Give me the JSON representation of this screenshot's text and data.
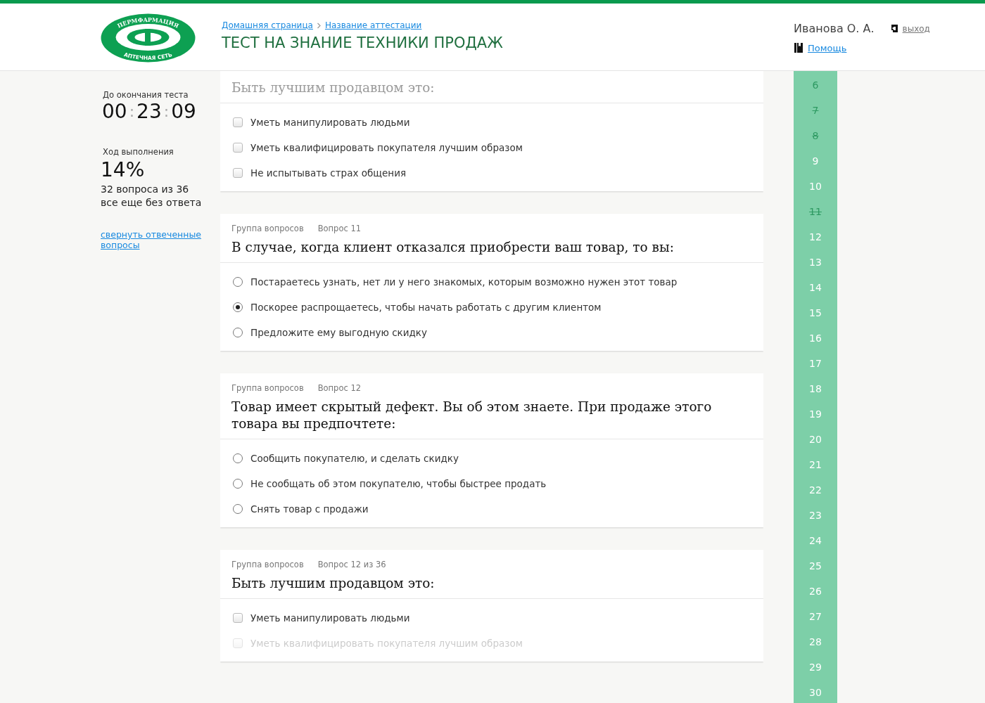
{
  "logo": {
    "top_text": "ПЕРМФАРМАЦИЯ",
    "bottom_text": "АПТЕЧНАЯ СЕТЬ"
  },
  "breadcrumbs": [
    "Домашняя страница",
    "Название аттестации"
  ],
  "page_title": "ТЕСТ НА ЗНАНИЕ ТЕХНИКИ ПРОДАЖ",
  "user": {
    "name": "Иванова О. А.",
    "logout": "выход",
    "help": "Помощь"
  },
  "timer": {
    "label": "До окончания теста",
    "hours": "00",
    "separator_1": ":",
    "minutes": "23",
    "separator_2": ":",
    "seconds": "09"
  },
  "progress": {
    "label": "Ход выполнения",
    "percent": "14%",
    "remaining": "32 вопроса из 36",
    "remaining_note": "все еще без ответа",
    "collapse_link": "свернуть отвеченные вопросы"
  },
  "questions": [
    {
      "title": "Быть лучшим продавцом это:",
      "kind": "checkbox",
      "options": [
        {
          "text": "Уметь манипулировать людьми",
          "checked": false
        },
        {
          "text": "Уметь квалифицировать покупателя лучшим образом",
          "checked": false
        },
        {
          "text": "Не испытывать страх общения",
          "checked": false
        }
      ]
    },
    {
      "group": "Группа вопросов",
      "number": "Вопрос 11",
      "title": "В случае, когда клиент отказался приобрести ваш товар, то вы:",
      "kind": "radio",
      "options": [
        {
          "text": "Постараетесь узнать, нет ли у него знакомых, которым возможно нужен этот товар",
          "selected": false
        },
        {
          "text": "Поскорее распрощаетесь, чтобы начать работать с другим клиентом",
          "selected": true
        },
        {
          "text": "Предложите ему выгодную скидку",
          "selected": false
        }
      ]
    },
    {
      "group": "Группа вопросов",
      "number": "Вопрос 12",
      "title": "Товар имеет скрытый дефект. Вы об этом знаете. При продаже этого товара вы предпочтете:",
      "kind": "radio",
      "options": [
        {
          "text": "Сообщить покупателю, и сделать скидку",
          "selected": false
        },
        {
          "text": "Не сообщать об этом покупателю, чтобы быстрее продать",
          "selected": false
        },
        {
          "text": "Снять товар с продажи",
          "selected": false
        }
      ]
    },
    {
      "group": "Группа вопросов",
      "number": "Вопрос 12 из 36",
      "title": "Быть лучшим продавцом это:",
      "kind": "checkbox",
      "options": [
        {
          "text": "Уметь манипулировать людьми",
          "checked": false
        },
        {
          "text": "Уметь квалифицировать покупателя лучшим образом",
          "checked": false
        }
      ]
    }
  ],
  "question_nav": [
    {
      "label": "6",
      "answered": true,
      "crossed": false
    },
    {
      "label": "7",
      "answered": true,
      "crossed": true
    },
    {
      "label": "8",
      "answered": true,
      "crossed": true
    },
    {
      "label": "9",
      "answered": false,
      "crossed": false
    },
    {
      "label": "10",
      "answered": false,
      "crossed": false
    },
    {
      "label": "11",
      "answered": true,
      "crossed": true
    },
    {
      "label": "12",
      "answered": false,
      "crossed": false
    },
    {
      "label": "13",
      "answered": false,
      "crossed": false
    },
    {
      "label": "14",
      "answered": false,
      "crossed": false
    },
    {
      "label": "15",
      "answered": false,
      "crossed": false
    },
    {
      "label": "16",
      "answered": false,
      "crossed": false
    },
    {
      "label": "17",
      "answered": false,
      "crossed": false
    },
    {
      "label": "18",
      "answered": false,
      "crossed": false
    },
    {
      "label": "19",
      "answered": false,
      "crossed": false
    },
    {
      "label": "20",
      "answered": false,
      "crossed": false
    },
    {
      "label": "21",
      "answered": false,
      "crossed": false
    },
    {
      "label": "22",
      "answered": false,
      "crossed": false
    },
    {
      "label": "23",
      "answered": false,
      "crossed": false
    },
    {
      "label": "24",
      "answered": false,
      "crossed": false
    },
    {
      "label": "25",
      "answered": false,
      "crossed": false
    },
    {
      "label": "26",
      "answered": false,
      "crossed": false
    },
    {
      "label": "27",
      "answered": false,
      "crossed": false
    },
    {
      "label": "28",
      "answered": false,
      "crossed": false
    },
    {
      "label": "29",
      "answered": false,
      "crossed": false
    },
    {
      "label": "30",
      "answered": false,
      "crossed": false
    }
  ]
}
